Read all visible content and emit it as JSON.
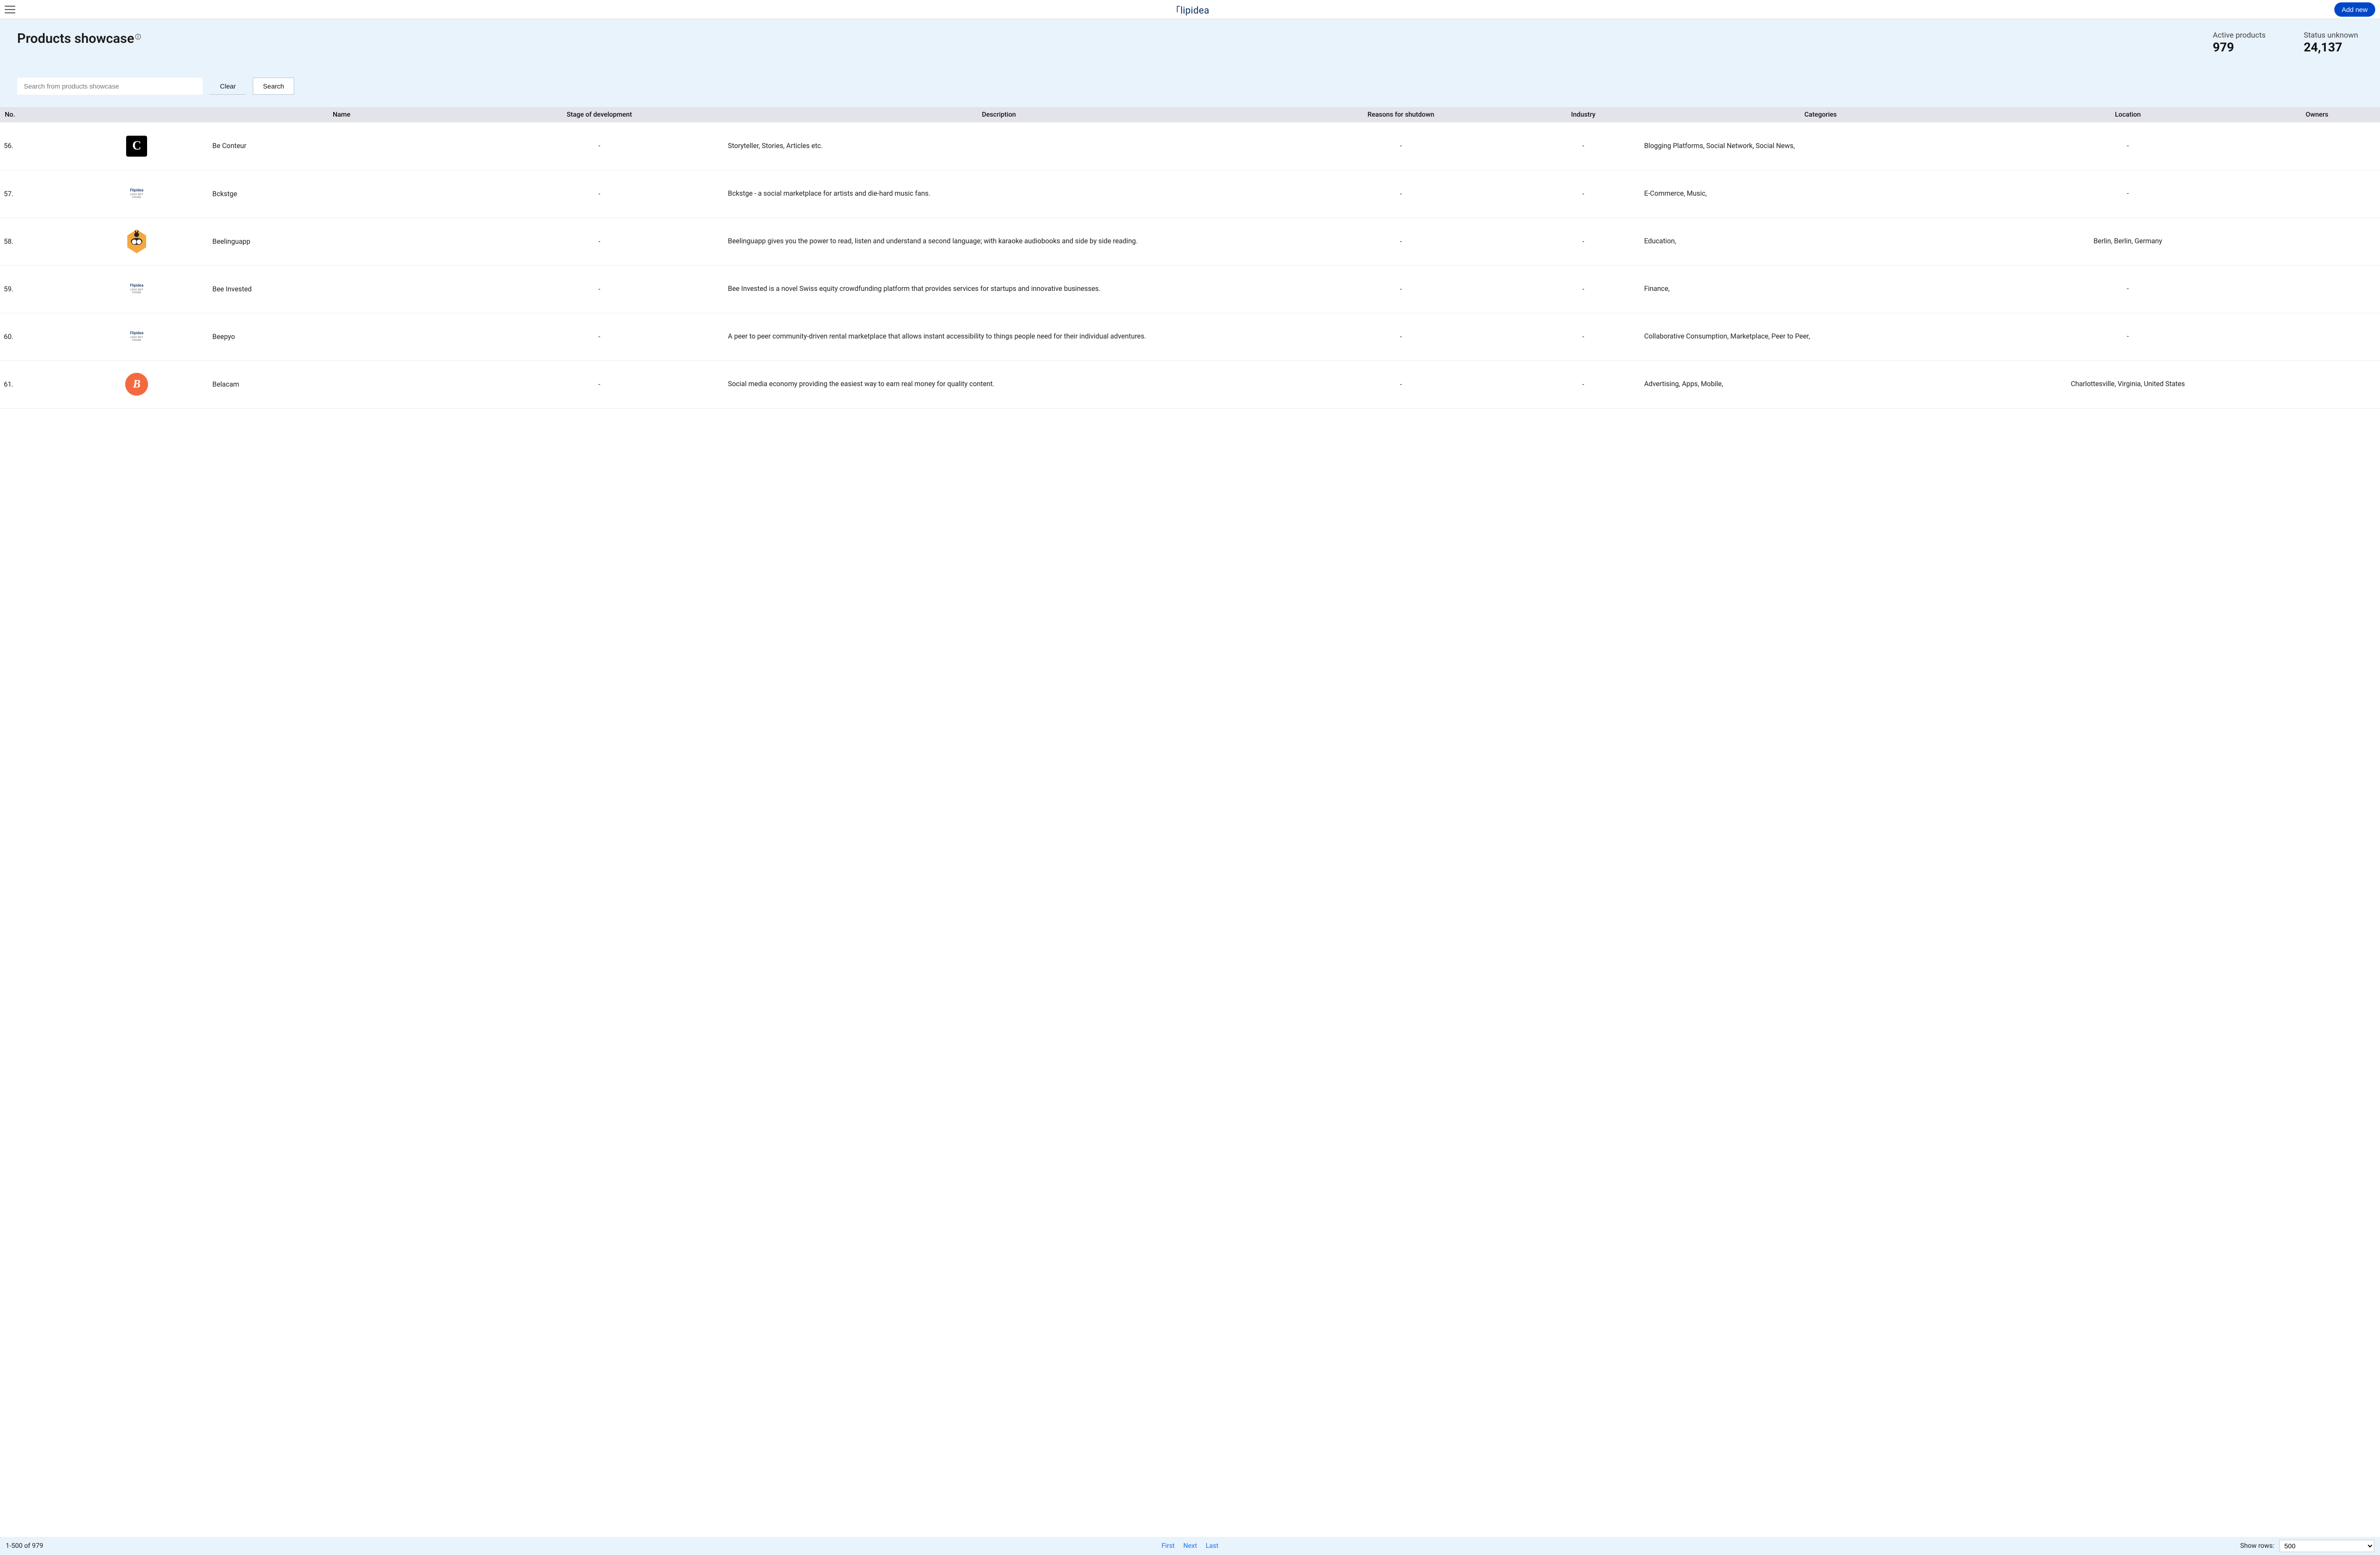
{
  "brand": "lipidea",
  "header": {
    "add_new_label": "Add new"
  },
  "page": {
    "title": "Products showcase",
    "info_badge": "i"
  },
  "stats": {
    "active": {
      "label": "Active products",
      "value": "979"
    },
    "unknown": {
      "label": "Status unknown",
      "value": "24,137"
    }
  },
  "search": {
    "placeholder": "Search from products showcase",
    "clear_label": "Clear",
    "search_label": "Search"
  },
  "columns": {
    "no": "No.",
    "name": "Name",
    "stage": "Stage of development",
    "description": "Description",
    "reasons": "Reasons for shutdown",
    "industry": "Industry",
    "categories": "Categories",
    "location": "Location",
    "owners": "Owners"
  },
  "logo_placeholder": {
    "brand": "Flipidea",
    "notfound": "LOGO NOT FOUND"
  },
  "rows": [
    {
      "no": "56.",
      "logo_type": "black",
      "logo_text": "C",
      "name": "Be Conteur",
      "stage": "-",
      "description": "Storyteller, Stories, Articles etc.",
      "reasons": "-",
      "industry": "-",
      "categories": "Blogging Platforms, Social Network, Social News,",
      "location": "-"
    },
    {
      "no": "57.",
      "logo_type": "placeholder",
      "name": "Bckstge",
      "stage": "-",
      "description": "Bckstge - a social marketplace for artists and die-hard music fans.",
      "reasons": "-",
      "industry": "-",
      "categories": "E-Commerce, Music,",
      "location": "-"
    },
    {
      "no": "58.",
      "logo_type": "bee",
      "name": "Beelinguapp",
      "stage": "-",
      "description": "Beelinguapp gives you the power to read, listen and understand a second language; with karaoke audiobooks and side by side reading.",
      "reasons": "-",
      "industry": "-",
      "categories": "Education,",
      "location": "Berlin, Berlin, Germany"
    },
    {
      "no": "59.",
      "logo_type": "placeholder",
      "name": "Bee Invested",
      "stage": "-",
      "description": "Bee Invested is a novel Swiss equity crowdfunding platform that provides services for startups and innovative businesses.",
      "reasons": "-",
      "industry": "-",
      "categories": "Finance,",
      "location": "-"
    },
    {
      "no": "60.",
      "logo_type": "placeholder",
      "name": "Beepyo",
      "stage": "-",
      "description": "A peer to peer community-driven rental marketplace that allows instant accessibility to things people need for their individual adventures.",
      "reasons": "-",
      "industry": "-",
      "categories": "Collaborative Consumption, Marketplace, Peer to Peer,",
      "location": "-"
    },
    {
      "no": "61.",
      "logo_type": "orange",
      "logo_text": "B",
      "name": "Belacam",
      "stage": "-",
      "description": "Social media economy providing the easiest way to earn real money for quality content.",
      "reasons": "-",
      "industry": "-",
      "categories": "Advertising, Apps, Mobile,",
      "location": "Charlottesville, Virginia, United States"
    }
  ],
  "footer": {
    "range": "1-500 of 979",
    "first": "First",
    "next": "Next",
    "last": "Last",
    "show_rows_label": "Show rows:",
    "rows_selected": "500"
  }
}
